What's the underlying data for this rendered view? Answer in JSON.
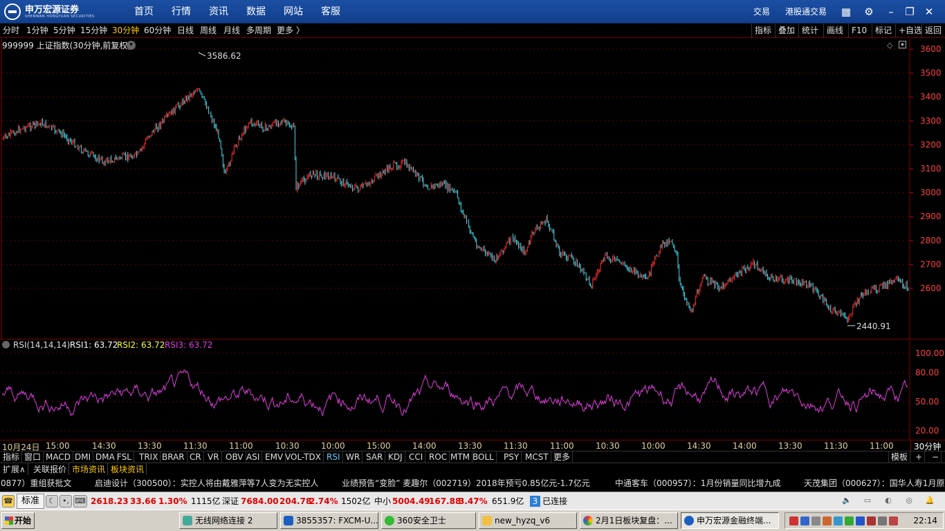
{
  "app": {
    "brand_cn": "申万宏源证券",
    "brand_en": "SHENWAN HONGYUAN SECURITIES",
    "menu": [
      "首页",
      "行情",
      "资讯",
      "数据",
      "网站",
      "客服"
    ],
    "trade": "交易",
    "hk_trade": "港股通交易"
  },
  "periods": [
    "分时",
    "1分钟",
    "5分钟",
    "15分钟",
    "30分钟",
    "60分钟",
    "日线",
    "周线",
    "月线",
    "多周期",
    "更多 〉"
  ],
  "active_period": "30分钟",
  "right_tools": [
    "指标",
    "叠加",
    "统计",
    "画线",
    "F10",
    "标记",
    "+自选",
    "返回"
  ],
  "main": {
    "title": "999999 上证指数(30分钟,前复权)",
    "high_label": "3586.62",
    "low_label": "2440.91",
    "y_ticks": [
      "3600",
      "3500",
      "3400",
      "3300",
      "3200",
      "3100",
      "3000",
      "2900",
      "2800",
      "2700",
      "2600"
    ],
    "colors": {
      "up": "#ff3030",
      "down": "#40e0f0",
      "grid": "#6a0000",
      "axis_text": "#ff4040"
    }
  },
  "rsi": {
    "name": "RSI(14,14,14)",
    "rsi1": "RSI1: 63.72",
    "rsi2": "RSI2: 63.72",
    "rsi3": "RSI3: 63.72",
    "y_ticks": [
      "100.00",
      "80.00",
      "50.00",
      "20.00"
    ],
    "color": "#e040e0"
  },
  "time_axis": [
    "10月24日",
    "15:00",
    "14:30",
    "13:30",
    "11:30",
    "11:00",
    "10:30",
    "10:00",
    "15:00",
    "14:00",
    "13:30",
    "11:30",
    "11:00",
    "10:30",
    "10:00",
    "14:30",
    "14:00",
    "13:30",
    "11:30",
    "11:00"
  ],
  "time_axis_right": "30分钟",
  "indicators": [
    "指标",
    "窗口",
    "MACD",
    "DMI",
    "DMA",
    "FSL",
    "TRIX",
    "BRAR",
    "CR",
    "VR",
    "OBV",
    "ASI",
    "EMV",
    "VOL-TDX",
    "RSI",
    "WR",
    "SAR",
    "KDJ",
    "CCI",
    "ROC",
    "MTM",
    "BOLL",
    "PSY",
    "MCST",
    "更多"
  ],
  "active_indicator": "RSI",
  "indicator_right": [
    "模板",
    "+",
    "−"
  ],
  "ext_tabs": [
    "扩展∧",
    "关联报价",
    "市场资讯",
    "板块资讯"
  ],
  "ticker": [
    "0877）重组获批文",
    "启迪设计（300500）：实控人将由戴雅萍等7人变为无实控人",
    "业绩预告“变脸” 麦趣尔（002719）2018年预亏0.85亿元-1.7亿元",
    "中通客车（000957）：1月份销量同比增九成",
    "天茂集团（000627）：国华人寿1月原"
  ],
  "status": {
    "mode": "标准",
    "sh_val": "2618.23",
    "sh_chg": "33.66",
    "sh_pct": "1.30%",
    "sh_amt": "1115亿",
    "sz_name": "深证",
    "sz_val": "7684.00",
    "sz_chg": "204.78",
    "sz_pct": "2.74%",
    "sz_amt": "1502亿",
    "zx_name": "中小",
    "zx_val": "5004.49",
    "zx_chg": "167.88",
    "zx_pct": "3.47%",
    "zx_amt": "651.9亿",
    "conn_num": "3",
    "conn_text": "已连接"
  },
  "taskbar": {
    "start": "开始",
    "tasks": [
      "无线网络连接 2",
      "3855357: FXCM-U...",
      "360安全卫士",
      "new_hyzq_v6",
      "2月1日板块复盘：...",
      "申万宏源金融终端..."
    ],
    "clock": "22:14"
  }
}
